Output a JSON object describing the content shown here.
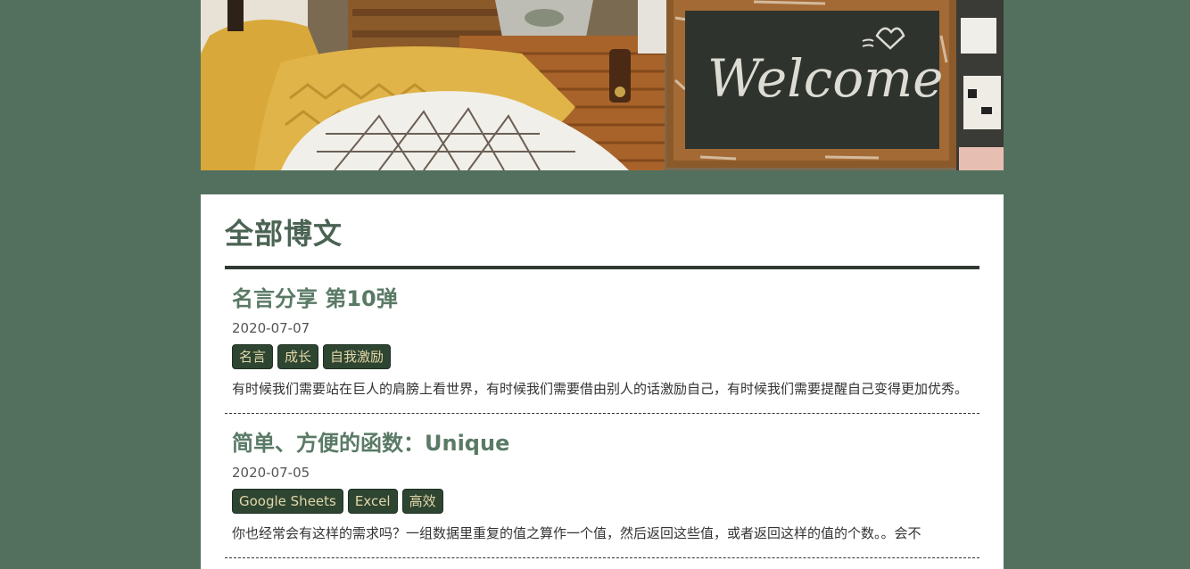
{
  "banner": {
    "image_text": "Welcome",
    "colors": {
      "chalkboard": "#2f332d",
      "frame": "#8b5a2b",
      "blanket": "#d9a83a",
      "basket": "#a8632a"
    }
  },
  "page": {
    "title": "全部博文"
  },
  "posts": [
    {
      "title": "名言分享 第10弹",
      "date": "2020-07-07",
      "tags": [
        "名言",
        "成长",
        "自我激励"
      ],
      "excerpt": "有时候我们需要站在巨人的肩膀上看世界，有时候我们需要借由别人的话激励自己，有时候我们需要提醒自己变得更加优秀。"
    },
    {
      "title": "简单、方便的函数：Unique",
      "date": "2020-07-05",
      "tags": [
        "Google Sheets",
        "Excel",
        "高效"
      ],
      "excerpt": "你也经常会有这样的需求吗？一组数据里重复的值之算作一个值，然后返回这些值，或者返回这样的值的个数。。会不"
    }
  ],
  "theme": {
    "background": "#53705f",
    "title_color": "#4a6353",
    "post_title_color": "#5a7a66",
    "tag_bg": "#2d4531",
    "tag_text": "#e3d6a8"
  }
}
